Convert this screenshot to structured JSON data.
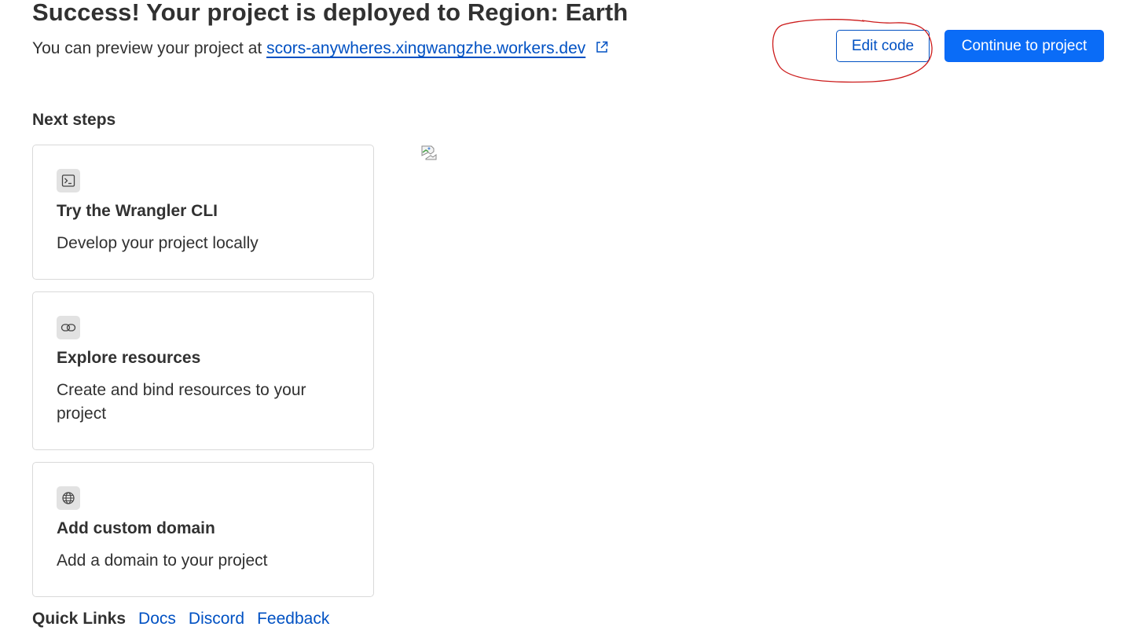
{
  "header": {
    "title": "Success! Your project is deployed to Region: Earth",
    "preview_prefix": "You can preview your project at",
    "preview_url": "scors-anywheres.xingwangzhe.workers.dev",
    "external_link_icon": "external-link-icon"
  },
  "actions": {
    "edit_code_label": "Edit code",
    "continue_label": "Continue to project",
    "accent_color": "#0051c3",
    "primary_color": "#0a6cf7",
    "annotation_color": "#cc1b1b"
  },
  "next_steps": {
    "title": "Next steps",
    "cards": [
      {
        "icon": "terminal-icon",
        "title": "Try the Wrangler CLI",
        "description": "Develop your project locally"
      },
      {
        "icon": "link-icon",
        "title": "Explore resources",
        "description": "Create and bind resources to your project"
      },
      {
        "icon": "globe-icon",
        "title": "Add custom domain",
        "description": "Add a domain to your project"
      }
    ]
  },
  "image_placeholder": {
    "icon": "broken-image-icon"
  },
  "quick_links": {
    "label": "Quick Links",
    "links": [
      "Docs",
      "Discord",
      "Feedback"
    ]
  }
}
